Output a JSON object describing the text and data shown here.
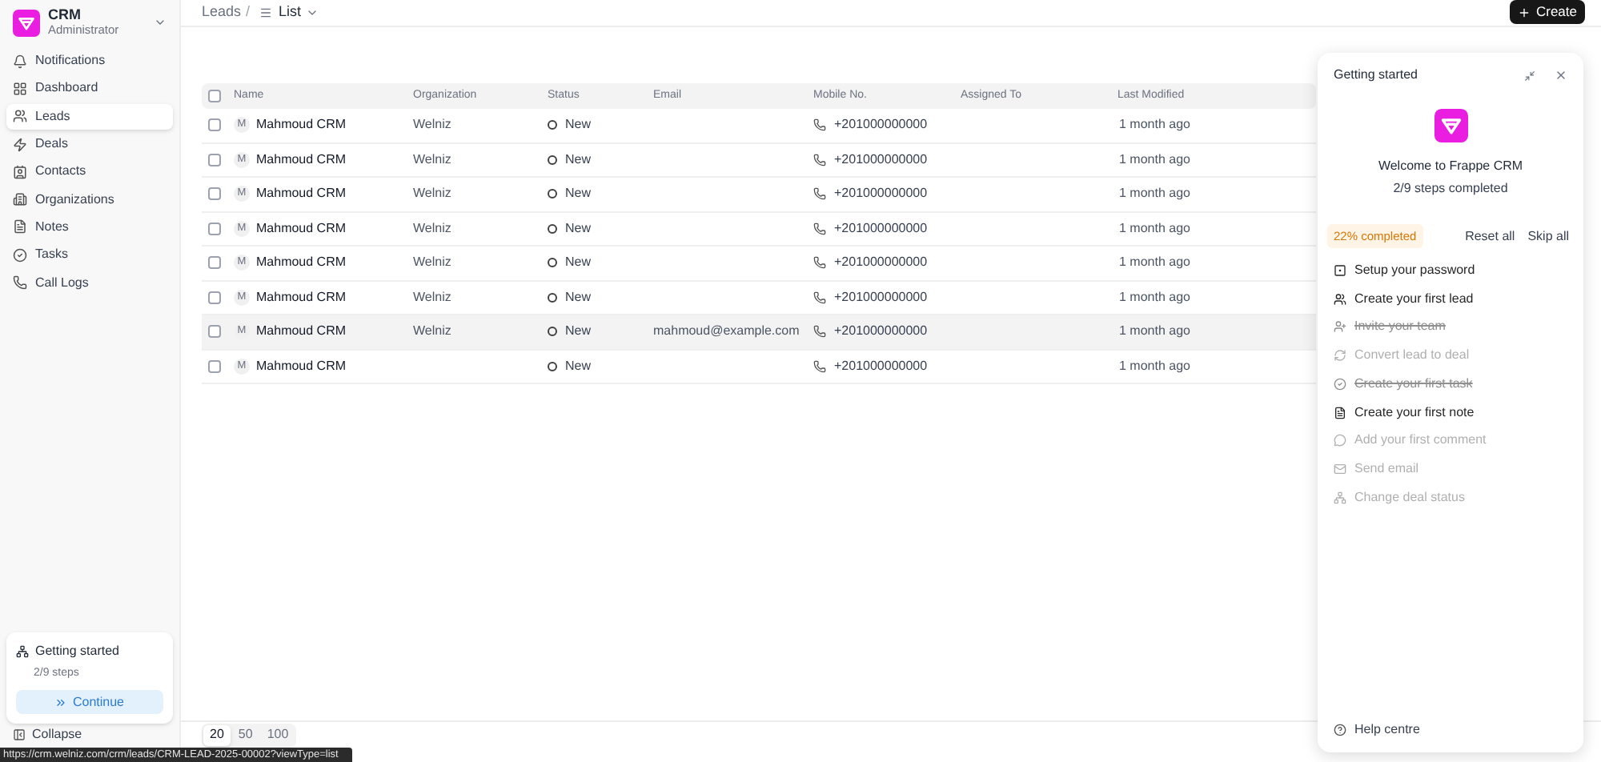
{
  "app": {
    "name": "CRM",
    "role": "Administrator"
  },
  "sidebar": {
    "items": [
      {
        "label": "Notifications",
        "selected": false
      },
      {
        "label": "Dashboard",
        "selected": false
      },
      {
        "label": "Leads",
        "selected": true
      },
      {
        "label": "Deals",
        "selected": false
      },
      {
        "label": "Contacts",
        "selected": false
      },
      {
        "label": "Organizations",
        "selected": false
      },
      {
        "label": "Notes",
        "selected": false
      },
      {
        "label": "Tasks",
        "selected": false
      },
      {
        "label": "Call Logs",
        "selected": false
      }
    ],
    "getting_started": {
      "title": "Getting started",
      "steps": "2/9 steps",
      "button": "Continue"
    },
    "collapse": "Collapse"
  },
  "breadcrumb": {
    "parent": "Leads",
    "separator": "/",
    "view": "List"
  },
  "create_button": "Create",
  "table": {
    "select_all_checked": false,
    "columns": [
      "Name",
      "Organization",
      "Status",
      "Email",
      "Mobile No.",
      "Assigned To",
      "Last Modified"
    ],
    "rows": [
      {
        "checked": false,
        "initial": "M",
        "name": "Mahmoud CRM",
        "organization": "Welniz",
        "status": "New",
        "email": "",
        "mobile": "+201000000000",
        "modified": "1 month ago",
        "highlighted": false
      },
      {
        "checked": false,
        "initial": "M",
        "name": "Mahmoud CRM",
        "organization": "Welniz",
        "status": "New",
        "email": "",
        "mobile": "+201000000000",
        "modified": "1 month ago",
        "highlighted": false
      },
      {
        "checked": false,
        "initial": "M",
        "name": "Mahmoud CRM",
        "organization": "Welniz",
        "status": "New",
        "email": "",
        "mobile": "+201000000000",
        "modified": "1 month ago",
        "highlighted": false
      },
      {
        "checked": false,
        "initial": "M",
        "name": "Mahmoud CRM",
        "organization": "Welniz",
        "status": "New",
        "email": "",
        "mobile": "+201000000000",
        "modified": "1 month ago",
        "highlighted": false
      },
      {
        "checked": false,
        "initial": "M",
        "name": "Mahmoud CRM",
        "organization": "Welniz",
        "status": "New",
        "email": "",
        "mobile": "+201000000000",
        "modified": "1 month ago",
        "highlighted": false
      },
      {
        "checked": false,
        "initial": "M",
        "name": "Mahmoud CRM",
        "organization": "Welniz",
        "status": "New",
        "email": "",
        "mobile": "+201000000000",
        "modified": "1 month ago",
        "highlighted": false
      },
      {
        "checked": false,
        "initial": "M",
        "name": "Mahmoud CRM",
        "organization": "Welniz",
        "status": "New",
        "email": "mahmoud@example.com",
        "mobile": "+201000000000",
        "modified": "1 month ago",
        "highlighted": true
      },
      {
        "checked": false,
        "initial": "M",
        "name": "Mahmoud CRM",
        "organization": "",
        "status": "New",
        "email": "",
        "mobile": "+201000000000",
        "modified": "1 month ago",
        "highlighted": false
      }
    ]
  },
  "page_sizes": [
    {
      "label": "20",
      "selected": true
    },
    {
      "label": "50",
      "selected": false
    },
    {
      "label": "100",
      "selected": false
    }
  ],
  "status_url": "https://crm.welniz.com/crm/leads/CRM-LEAD-2025-00002?viewType=list",
  "panel": {
    "title": "Getting started",
    "welcome": "Welcome to Frappe CRM",
    "progress_text": "2/9 steps completed",
    "percent": "22% completed",
    "reset": "Reset all",
    "skip": "Skip all",
    "steps": [
      {
        "label": "Setup your password",
        "completed": false,
        "disabled": false
      },
      {
        "label": "Create your first lead",
        "completed": false,
        "disabled": false
      },
      {
        "label": "Invite your team",
        "completed": true,
        "disabled": false
      },
      {
        "label": "Convert lead to deal",
        "completed": false,
        "disabled": true
      },
      {
        "label": "Create your first task",
        "completed": true,
        "disabled": false
      },
      {
        "label": "Create your first note",
        "completed": false,
        "disabled": false
      },
      {
        "label": "Add your first comment",
        "completed": false,
        "disabled": true
      },
      {
        "label": "Send email",
        "completed": false,
        "disabled": true
      },
      {
        "label": "Change deal status",
        "completed": false,
        "disabled": true
      }
    ],
    "help": "Help centre"
  }
}
